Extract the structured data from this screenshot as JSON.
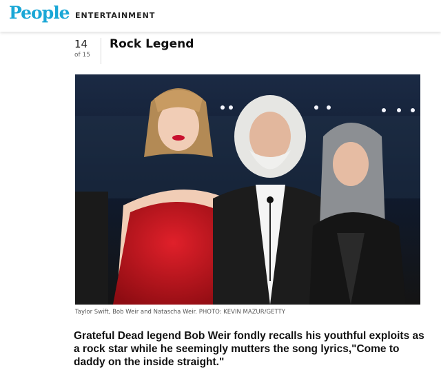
{
  "header": {
    "logo_text": "People",
    "section_label": "ENTERTAINMENT",
    "colors": {
      "logo": "#1aa7d6"
    }
  },
  "slide": {
    "index": "14",
    "total": "of 15",
    "title": "Rock Legend"
  },
  "photo": {
    "caption": "Taylor Swift, Bob Weir and Natascha Weir. PHOTO: KEVIN MAZUR/GETTY"
  },
  "overlay_text": "Grateful Dead legend Bob Weir fondly recalls his youthful exploits as a rock star while he seemingly mutters the song lyrics,\"Come to daddy on the inside straight.\""
}
